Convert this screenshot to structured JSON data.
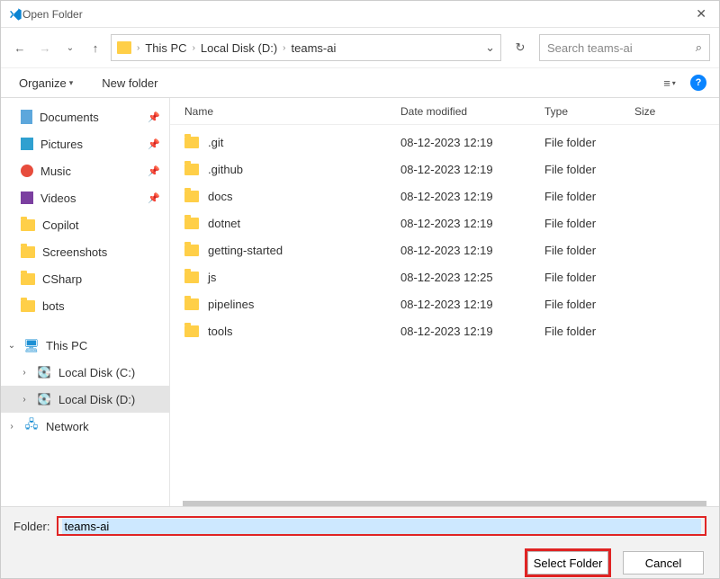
{
  "window": {
    "title": "Open Folder"
  },
  "breadcrumb": {
    "root": "This PC",
    "drive": "Local Disk (D:)",
    "folder": "teams-ai"
  },
  "search": {
    "placeholder": "Search teams-ai"
  },
  "toolbar": {
    "organize": "Organize",
    "new_folder": "New folder"
  },
  "columns": {
    "name": "Name",
    "date": "Date modified",
    "type": "Type",
    "size": "Size"
  },
  "quick_access": [
    {
      "label": "Documents",
      "icon": "doc",
      "pinned": true
    },
    {
      "label": "Pictures",
      "icon": "pic",
      "pinned": true
    },
    {
      "label": "Music",
      "icon": "mus",
      "pinned": true
    },
    {
      "label": "Videos",
      "icon": "vid",
      "pinned": true
    },
    {
      "label": "Copilot",
      "icon": "folder",
      "pinned": false
    },
    {
      "label": "Screenshots",
      "icon": "folder",
      "pinned": false
    },
    {
      "label": "CSharp",
      "icon": "folder",
      "pinned": false
    },
    {
      "label": "bots",
      "icon": "folder",
      "pinned": false
    }
  ],
  "tree": {
    "this_pc": "This PC",
    "drive_c": "Local Disk (C:)",
    "drive_d": "Local Disk (D:)",
    "network": "Network"
  },
  "files": [
    {
      "name": ".git",
      "date": "08-12-2023 12:19",
      "type": "File folder"
    },
    {
      "name": ".github",
      "date": "08-12-2023 12:19",
      "type": "File folder"
    },
    {
      "name": "docs",
      "date": "08-12-2023 12:19",
      "type": "File folder"
    },
    {
      "name": "dotnet",
      "date": "08-12-2023 12:19",
      "type": "File folder"
    },
    {
      "name": "getting-started",
      "date": "08-12-2023 12:19",
      "type": "File folder"
    },
    {
      "name": "js",
      "date": "08-12-2023 12:25",
      "type": "File folder"
    },
    {
      "name": "pipelines",
      "date": "08-12-2023 12:19",
      "type": "File folder"
    },
    {
      "name": "tools",
      "date": "08-12-2023 12:19",
      "type": "File folder"
    }
  ],
  "footer": {
    "folder_label": "Folder:",
    "folder_value": "teams-ai",
    "select_btn": "Select Folder",
    "cancel_btn": "Cancel"
  }
}
